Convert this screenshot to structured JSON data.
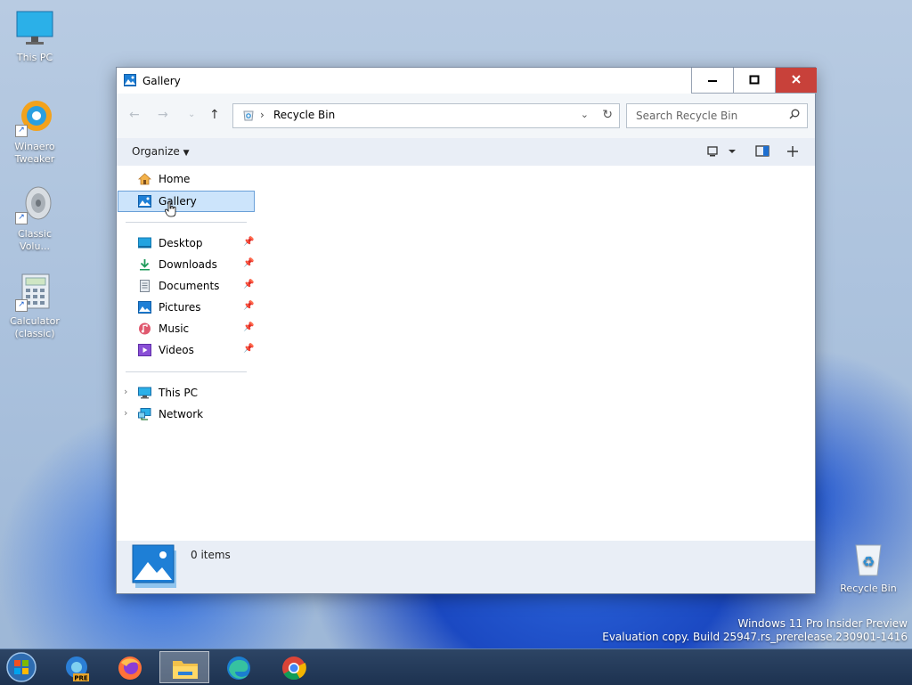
{
  "desktop": {
    "icons": [
      {
        "label": "This PC"
      },
      {
        "label": "Winaero Tweaker"
      },
      {
        "label": "Classic Volu..."
      },
      {
        "label": "Calculator (classic)"
      },
      {
        "label": "Recycle Bin"
      }
    ],
    "watermark": {
      "line1": "Windows 11 Pro Insider Preview",
      "line2": "Evaluation copy. Build 25947.rs_prerelease.230901-1416"
    }
  },
  "window": {
    "title": "Gallery",
    "controls": {
      "minimize": "–",
      "maximize": "☐",
      "close": "✕"
    },
    "address": {
      "path": "Recycle Bin",
      "separator": "›"
    },
    "search": {
      "placeholder": "Search Recycle Bin"
    },
    "commandbar": {
      "organize_label": "Organize"
    },
    "navpane": {
      "quick": [
        {
          "label": "Home",
          "icon": "home-icon"
        },
        {
          "label": "Gallery",
          "icon": "gallery-icon",
          "selected": true
        }
      ],
      "pinned": [
        {
          "label": "Desktop",
          "icon": "desktop-folder-icon"
        },
        {
          "label": "Downloads",
          "icon": "downloads-folder-icon"
        },
        {
          "label": "Documents",
          "icon": "documents-folder-icon"
        },
        {
          "label": "Pictures",
          "icon": "pictures-folder-icon"
        },
        {
          "label": "Music",
          "icon": "music-folder-icon"
        },
        {
          "label": "Videos",
          "icon": "videos-folder-icon"
        }
      ],
      "tree": [
        {
          "label": "This PC",
          "icon": "computer-icon"
        },
        {
          "label": "Network",
          "icon": "network-icon"
        }
      ]
    },
    "status": {
      "item_count": "0 items"
    }
  },
  "taskbar": {
    "apps": [
      {
        "name": "start-button"
      },
      {
        "name": "edge-preview-icon",
        "badge": "PRE"
      },
      {
        "name": "firefox-icon"
      },
      {
        "name": "file-explorer-icon",
        "active": true
      },
      {
        "name": "edge-icon"
      },
      {
        "name": "chrome-icon"
      }
    ]
  },
  "colors": {
    "accent": "#0078d4",
    "close": "#c8413a",
    "selection": "#cce4fb"
  }
}
